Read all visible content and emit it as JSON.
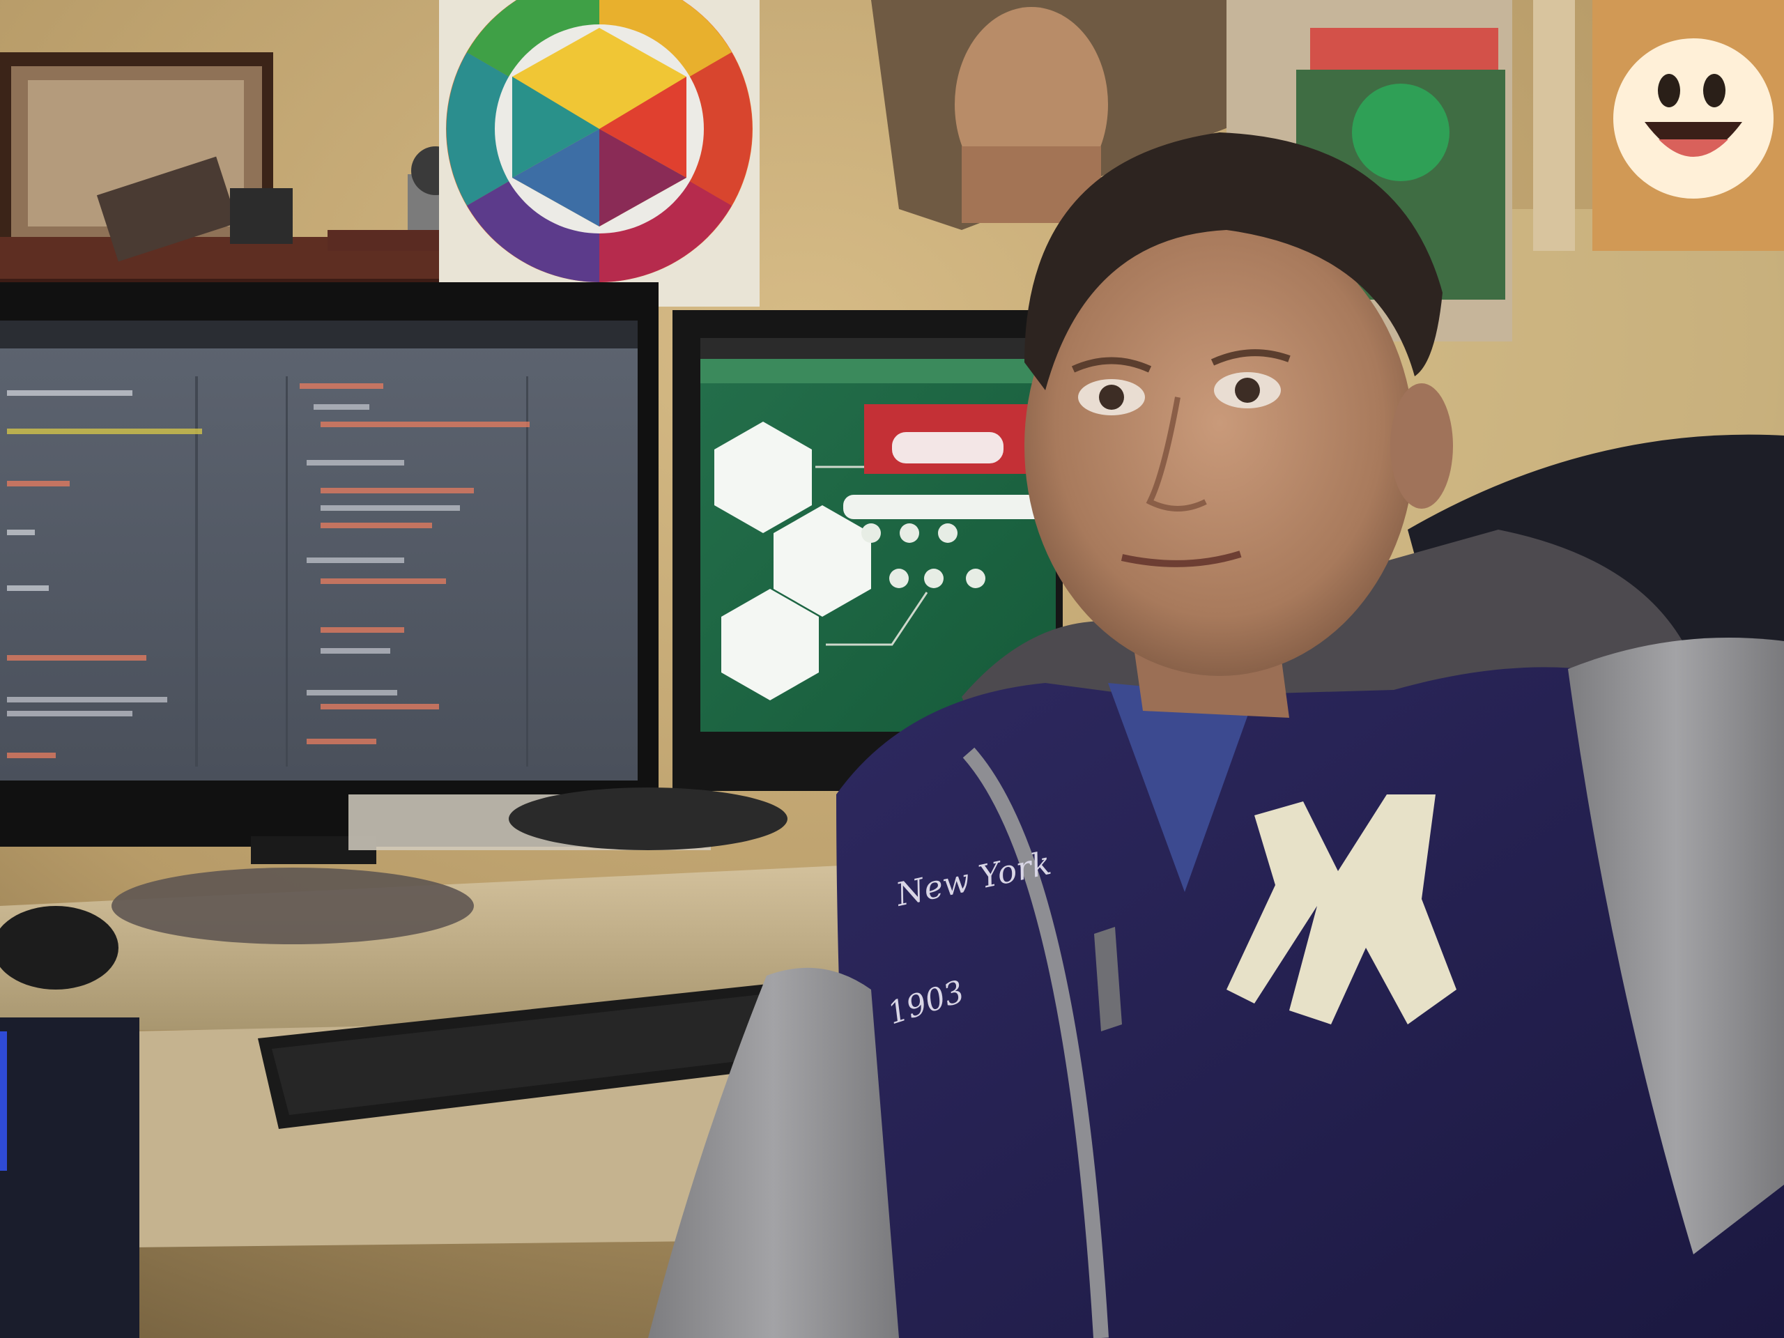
{
  "scene": {
    "kind": "photo",
    "subject": "selfie-at-desk",
    "palette": {
      "wall": "#c9ad7a",
      "wall_shadow": "#7d6843",
      "shelf": "#6a3425",
      "desk": "#cbb995",
      "monitor_bezel": "#141414",
      "code_bg": "#535a67",
      "site_bg": "#1e6a47",
      "site_red": "#c43036",
      "jacket": "#27224f",
      "sleeve": "#8f8f92",
      "chair": "#1d1e27",
      "skin": "#b98a6c",
      "hair": "#2d2420",
      "logo_patch": "#e7e1c8"
    }
  },
  "jacket": {
    "embroidery_script": "New York",
    "embroidery_year": "1903"
  },
  "icons": {
    "color_wheel": "color-wheel-poster",
    "smiley": "awesome-face-poster",
    "logo": "ny-logo-patch"
  }
}
